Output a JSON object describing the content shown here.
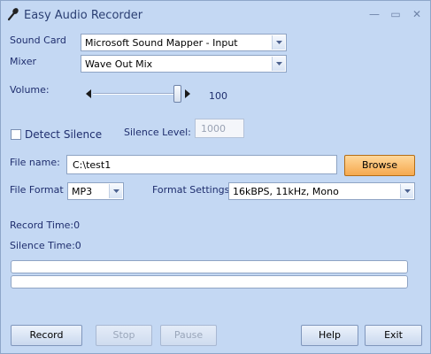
{
  "window": {
    "title": "Easy Audio Recorder",
    "minimize": "—",
    "maximize": "▭",
    "close": "✕"
  },
  "sound_card": {
    "label": "Sound Card",
    "value": "Microsoft Sound Mapper - Input"
  },
  "mixer": {
    "label": "Mixer",
    "value": "Wave Out Mix"
  },
  "volume": {
    "label": "Volume:",
    "value": "100",
    "level_fraction": 1.0
  },
  "detect_silence": {
    "label": "Detect Silence",
    "checked": false
  },
  "silence_level": {
    "label": "Silence Level:",
    "value": "1000"
  },
  "file_name": {
    "label": "File name:",
    "value": "C:\\test1",
    "browse": "Browse"
  },
  "file_format": {
    "label": "File Format",
    "value": "MP3"
  },
  "format_settings": {
    "label": "Format Settings",
    "value": "16kBPS, 11kHz, Mono"
  },
  "status": {
    "record_time": "Record Time:0",
    "silence_time": "Silence Time:0"
  },
  "buttons": {
    "record": "Record",
    "stop": "Stop",
    "pause": "Pause",
    "help": "Help",
    "exit": "Exit"
  },
  "colors": {
    "background": "#c4d8f3",
    "label_text": "#1f2e6e",
    "browse_highlight": "#f6a94e"
  }
}
